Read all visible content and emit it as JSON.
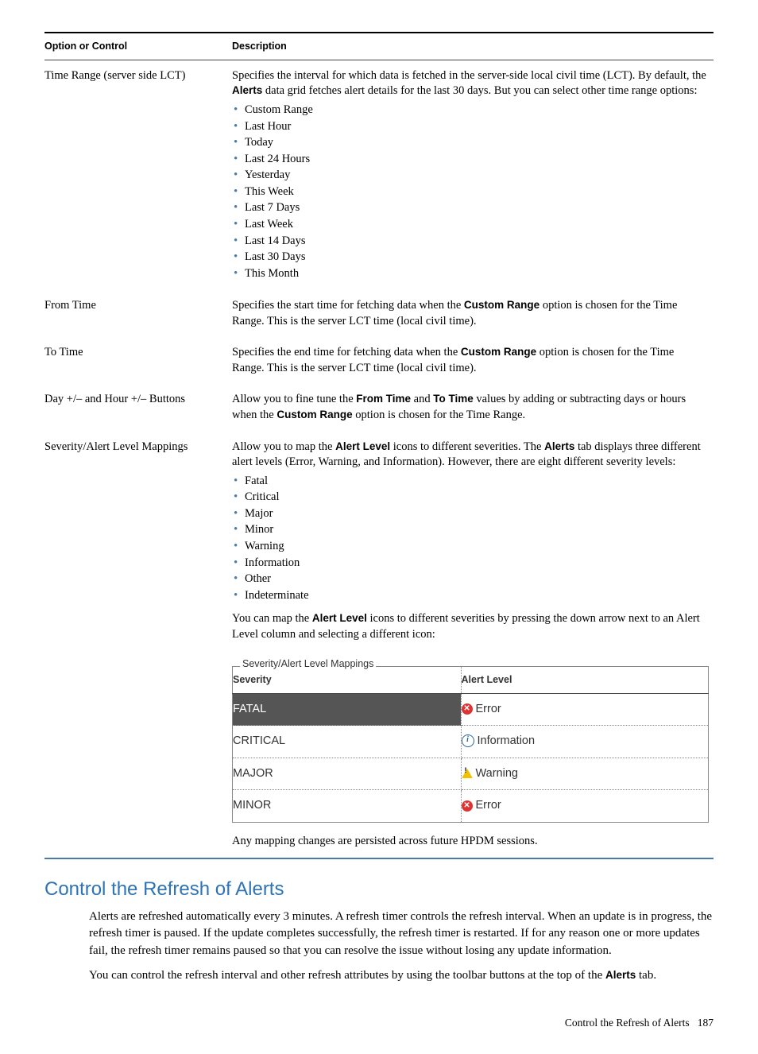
{
  "table": {
    "headers": {
      "option": "Option or Control",
      "desc": "Description"
    },
    "rows": {
      "timeRange": {
        "label": "Time Range (server side LCT)",
        "desc_pre": "Specifies the interval for which data is fetched in the server-side local civil time (LCT). By default, the ",
        "desc_bold": "Alerts",
        "desc_post": " data grid fetches alert details for the last 30 days. But you can select other time range options:",
        "items": [
          "Custom Range",
          "Last Hour",
          "Today",
          "Last 24 Hours",
          "Yesterday",
          "This Week",
          "Last 7 Days",
          "Last Week",
          "Last 14 Days",
          "Last 30 Days",
          "This Month"
        ]
      },
      "fromTime": {
        "label": "From Time",
        "desc_pre": "Specifies the start time for fetching data when the ",
        "desc_bold": "Custom Range",
        "desc_post": " option is chosen for the Time Range. This is the server LCT time (local civil time)."
      },
      "toTime": {
        "label": "To Time",
        "desc_pre": "Specifies the end time for fetching data when the ",
        "desc_bold": "Custom Range",
        "desc_post": " option is chosen for the Time Range. This is the server LCT time (local civil time)."
      },
      "dayHour": {
        "label": "Day +/– and Hour +/– Buttons",
        "p1a": "Allow you to fine tune the ",
        "p1b": "From Time",
        "p1c": " and ",
        "p1d": "To Time",
        "p1e": " values by adding or subtracting days or hours when the ",
        "p1f": "Custom Range",
        "p1g": " option is chosen for the Time Range."
      },
      "severity": {
        "label": "Severity/Alert Level Mappings",
        "p1a": "Allow you to map the ",
        "p1b": "Alert Level",
        "p1c": " icons to different severities. The ",
        "p1d": "Alerts",
        "p1e": " tab displays three different alert levels (Error, Warning, and Information). However, there are eight different severity levels:",
        "items": [
          "Fatal",
          "Critical",
          "Major",
          "Minor",
          "Warning",
          "Information",
          "Other",
          "Indeterminate"
        ],
        "p2a": "You can map the ",
        "p2b": "Alert Level",
        "p2c": " icons to different severities by pressing the down arrow next to an Alert Level column and selecting a different icon:",
        "legend": "Severity/Alert Level Mappings",
        "inner_headers": {
          "sev": "Severity",
          "al": "Alert Level"
        },
        "inner_rows": [
          {
            "sev": "FATAL",
            "al": "Error",
            "icon": "error",
            "hl": true
          },
          {
            "sev": "CRITICAL",
            "al": "Information",
            "icon": "info"
          },
          {
            "sev": "MAJOR",
            "al": "Warning",
            "icon": "warn"
          },
          {
            "sev": "MINOR",
            "al": "Error",
            "icon": "error"
          }
        ],
        "note": "Any mapping changes are persisted across future HPDM sessions."
      }
    }
  },
  "section": {
    "heading": "Control the Refresh of Alerts",
    "p1": "Alerts are refreshed automatically every 3 minutes. A refresh timer controls the refresh interval. When an update is in progress, the refresh timer is paused. If the update completes successfully, the refresh timer is restarted. If for any reason one or more updates fail, the refresh timer remains paused so that you can resolve the issue without losing any update information.",
    "p2a": "You can control the refresh interval and other refresh attributes by using the toolbar buttons at the top of the ",
    "p2b": "Alerts",
    "p2c": " tab."
  },
  "footer": {
    "text": "Control the Refresh of Alerts",
    "page": "187"
  }
}
